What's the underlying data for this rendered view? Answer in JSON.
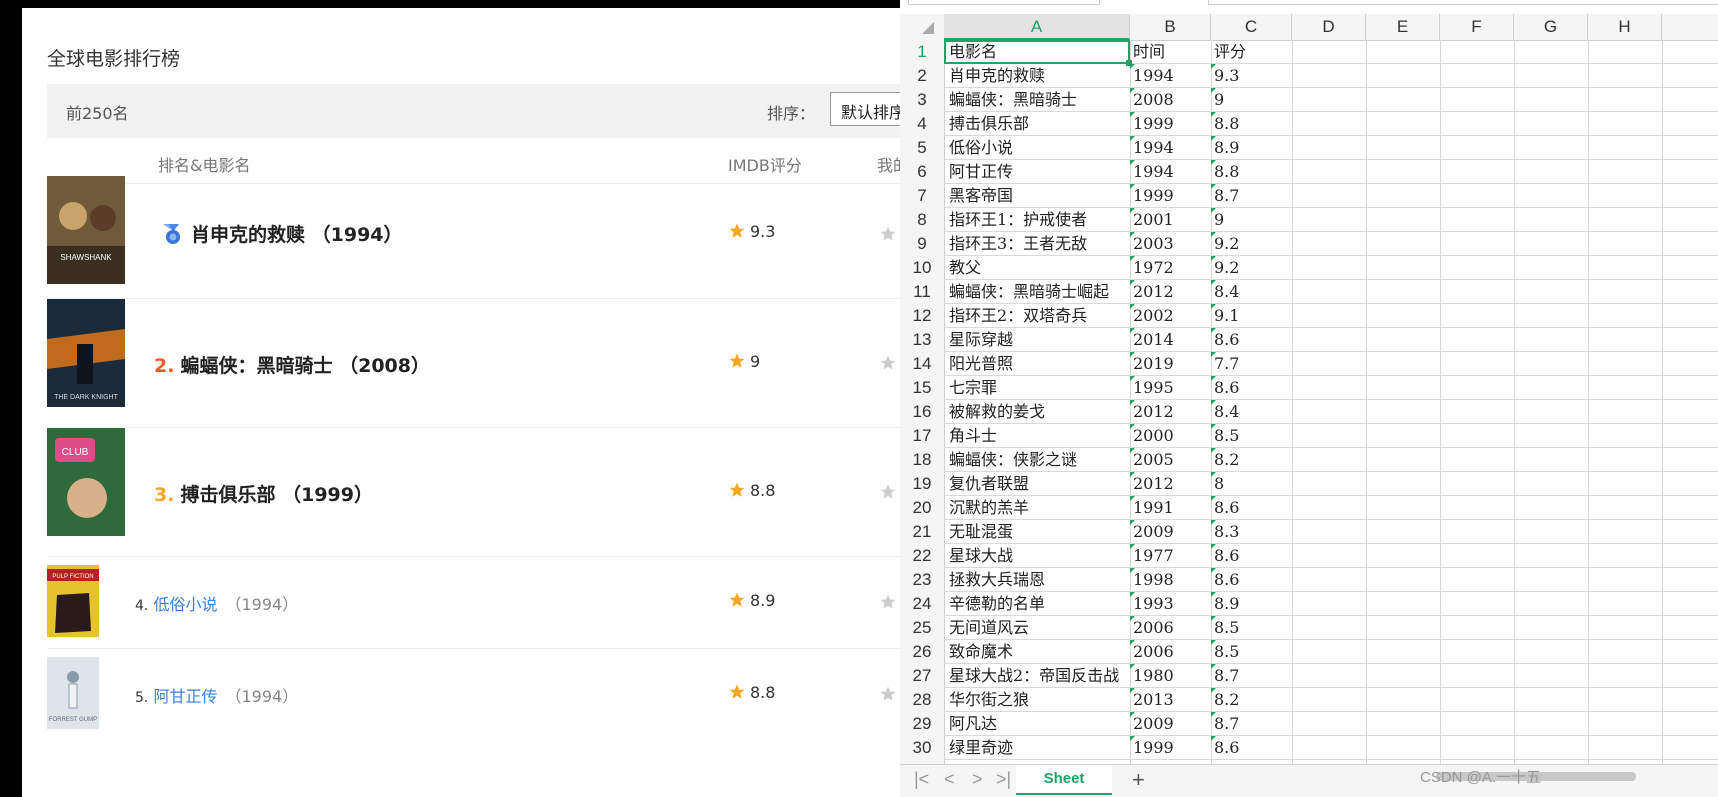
{
  "web": {
    "page_title": "全球电影排行榜",
    "filter_label": "前250名",
    "sort_label": "排序：",
    "sort_value": "默认排序",
    "header": {
      "name": "排名&电影名",
      "imdb": "IMDB评分",
      "mine": "我的评"
    },
    "movies": [
      {
        "rank": "",
        "title": "肖申克的救赎",
        "year": "（1994）",
        "score": "9.3",
        "poster_colors": [
          "#6f5a3a",
          "#c9a46a"
        ]
      },
      {
        "rank": "2.",
        "title": "蝙蝠侠：黑暗骑士",
        "year": "（2008）",
        "score": "9",
        "poster_colors": [
          "#1c2b3c",
          "#c06a1e"
        ]
      },
      {
        "rank": "3.",
        "title": "搏击俱乐部",
        "year": "（1999）",
        "score": "8.8",
        "poster_colors": [
          "#e04b8a",
          "#2f6a3a"
        ]
      },
      {
        "rank": "4.",
        "title": "低俗小说",
        "year": "（1994）",
        "score": "8.9",
        "poster_colors": [
          "#e6c32d",
          "#b52020"
        ]
      },
      {
        "rank": "5.",
        "title": "阿甘正传",
        "year": "（1994）",
        "score": "8.8",
        "poster_colors": [
          "#dfe4ea",
          "#8a9bb0"
        ]
      }
    ],
    "star_color": "#f5a623",
    "rank2_color": "#f15a22",
    "rank3_color": "#f5a623",
    "link_color": "#3a80d9"
  },
  "sheet": {
    "columns": [
      "A",
      "B",
      "C",
      "D",
      "E",
      "F",
      "G",
      "H"
    ],
    "active_column": "A",
    "header_row": [
      "电影名",
      "时间",
      "评分"
    ],
    "rows": [
      [
        "肖申克的救赎",
        "1994",
        "9.3"
      ],
      [
        "蝙蝠侠：黑暗骑士",
        "2008",
        "9"
      ],
      [
        "搏击俱乐部",
        "1999",
        "8.8"
      ],
      [
        "低俗小说",
        "1994",
        "8.9"
      ],
      [
        "阿甘正传",
        "1994",
        "8.8"
      ],
      [
        "黑客帝国",
        "1999",
        "8.7"
      ],
      [
        "指环王1：护戒使者",
        "2001",
        "9"
      ],
      [
        "指环王3：王者无敌",
        "2003",
        "9.2"
      ],
      [
        "教父",
        "1972",
        "9.2"
      ],
      [
        "蝙蝠侠：黑暗骑士崛起",
        "2012",
        "8.4"
      ],
      [
        "指环王2：双塔奇兵",
        "2002",
        "9.1"
      ],
      [
        "星际穿越",
        "2014",
        "8.6"
      ],
      [
        "阳光普照",
        "2019",
        "7.7"
      ],
      [
        "七宗罪",
        "1995",
        "8.6"
      ],
      [
        "被解救的姜戈",
        "2012",
        "8.4"
      ],
      [
        "角斗士",
        "2000",
        "8.5"
      ],
      [
        "蝙蝠侠：侠影之谜",
        "2005",
        "8.2"
      ],
      [
        "复仇者联盟",
        "2012",
        "8"
      ],
      [
        "沉默的羔羊",
        "1991",
        "8.6"
      ],
      [
        "无耻混蛋",
        "2009",
        "8.3"
      ],
      [
        "星球大战",
        "1977",
        "8.6"
      ],
      [
        "拯救大兵瑞恩",
        "1998",
        "8.6"
      ],
      [
        "辛德勒的名单",
        "1993",
        "8.9"
      ],
      [
        "无间道风云",
        "2006",
        "8.5"
      ],
      [
        "致命魔术",
        "2006",
        "8.5"
      ],
      [
        "星球大战2：帝国反击战",
        "1980",
        "8.7"
      ],
      [
        "华尔街之狼",
        "2013",
        "8.2"
      ],
      [
        "阿凡达",
        "2009",
        "8.7"
      ],
      [
        "绿里奇迹",
        "1999",
        "8.6"
      ]
    ],
    "sheet_tab": "Sheet",
    "add_tab": "+",
    "nav": [
      "|<",
      "<",
      ">",
      ">|"
    ],
    "accent": "#21a366"
  },
  "watermark": "CSDN @A.一十五"
}
